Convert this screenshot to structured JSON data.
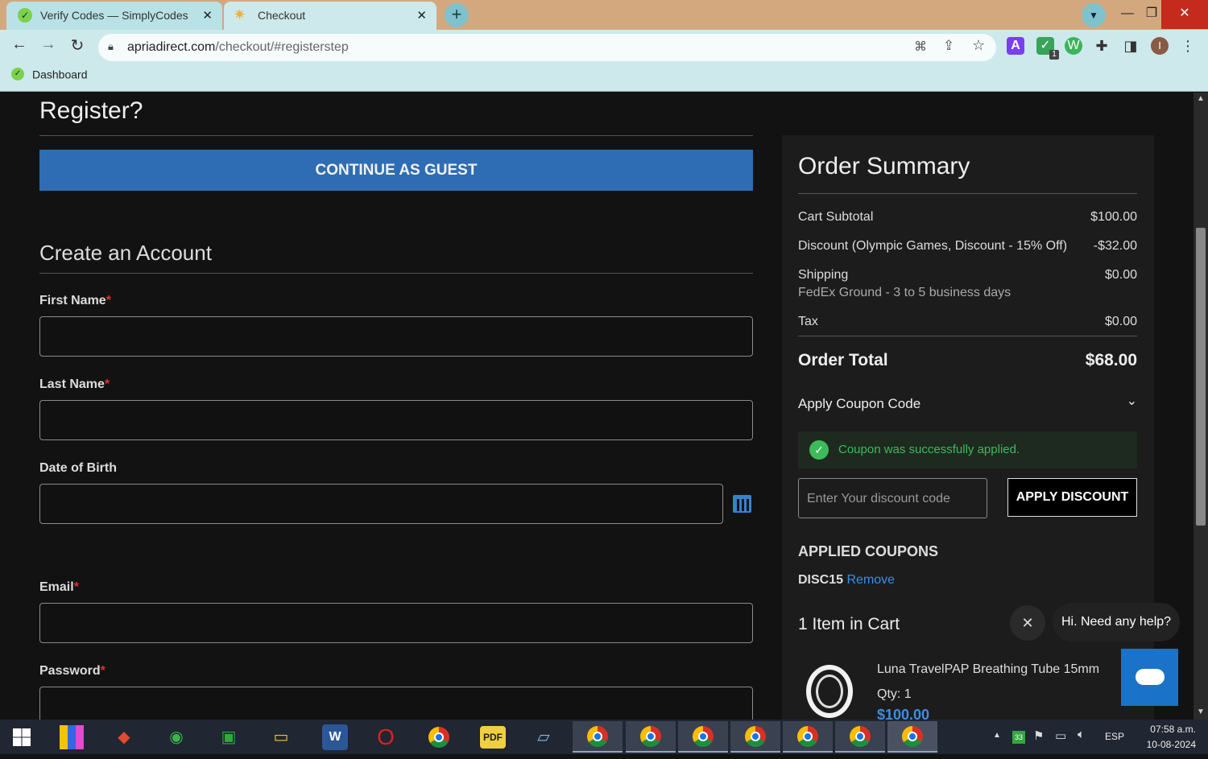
{
  "browser": {
    "tabs": [
      {
        "title": "Verify Codes — SimplyCodes",
        "icon": "simplycodes-icon"
      },
      {
        "title": "Checkout",
        "icon": "sun-icon"
      }
    ],
    "url_host": "apriadirect.com",
    "url_path": "/checkout/#registerstep",
    "bookmark": "Dashboard",
    "profile_initial": "I",
    "ext_badge": "1"
  },
  "page": {
    "register_heading": "Register?",
    "guest_button": "CONTINUE AS GUEST",
    "create_heading": "Create an Account",
    "first_name_label": "First Name",
    "last_name_label": "Last Name",
    "dob_label": "Date of Birth",
    "email_label": "Email",
    "password_label": "Password",
    "required_mark": "*"
  },
  "summary": {
    "title": "Order Summary",
    "subtotal_label": "Cart Subtotal",
    "subtotal_value": "$100.00",
    "discount_label": "Discount (Olympic Games, Discount - 15% Off)",
    "discount_value": "-$32.00",
    "shipping_label": "Shipping",
    "shipping_value": "$0.00",
    "shipping_method": "FedEx Ground - 3 to 5 business days",
    "tax_label": "Tax",
    "tax_value": "$0.00",
    "total_label": "Order Total",
    "total_value": "$68.00",
    "coupon_toggle": "Apply Coupon Code",
    "coupon_success": "Coupon was successfully applied.",
    "coupon_placeholder": "Enter Your discount code",
    "apply_button": "APPLY DISCOUNT",
    "applied_heading": "APPLIED COUPONS",
    "applied_code": "DISC15",
    "remove_link": "Remove",
    "items_heading": "1 Item in Cart",
    "product_name": "Luna TravelPAP Breathing Tube 15mm",
    "product_qty": "Qty: 1",
    "product_price": "$100.00"
  },
  "chat": {
    "bubble": "Hi. Need any help?"
  },
  "taskbar": {
    "tray_badge": "33",
    "language": "ESP",
    "time": "07:58 a.m.",
    "date": "10-08-2024"
  },
  "colors": {
    "guest_button_bg": "#2e6db4",
    "success_green": "#3dba5a",
    "link_blue": "#3a8ee6",
    "chat_blue": "#1a73c8"
  }
}
